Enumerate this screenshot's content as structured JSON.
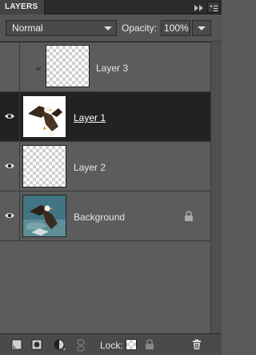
{
  "panel": {
    "tab_label": "LAYERS"
  },
  "options": {
    "blend_mode": "Normal",
    "opacity_label": "Opacity:",
    "opacity_value": "100%"
  },
  "layers": [
    {
      "name": "Layer 3",
      "visible": false,
      "selected": false,
      "thumbnail": "transparent"
    },
    {
      "name": "Layer 1",
      "visible": true,
      "selected": true,
      "thumbnail": "eagle-cutout"
    },
    {
      "name": "Layer 2",
      "visible": true,
      "selected": false,
      "thumbnail": "transparent"
    },
    {
      "name": "Background",
      "visible": true,
      "selected": false,
      "thumbnail": "eagle-photo",
      "locked": true
    }
  ],
  "toolbar": {
    "lock_label": "Lock:"
  },
  "icons": {
    "eye": "eye-icon",
    "lock": "lock-icon",
    "new_layer": "new-layer-icon",
    "mask": "layer-mask-icon",
    "adjustment": "adjustment-layer-icon",
    "link": "link-layers-icon",
    "lock_transparent": "lock-transparent-pixels-icon",
    "lock_all": "lock-all-icon",
    "delete": "trash-icon",
    "panel_menu": "panel-menu-icon",
    "collapse": "collapse-icon"
  },
  "colors": {
    "selected_row": "#222222",
    "panel_bg": "#5c5c5c"
  }
}
